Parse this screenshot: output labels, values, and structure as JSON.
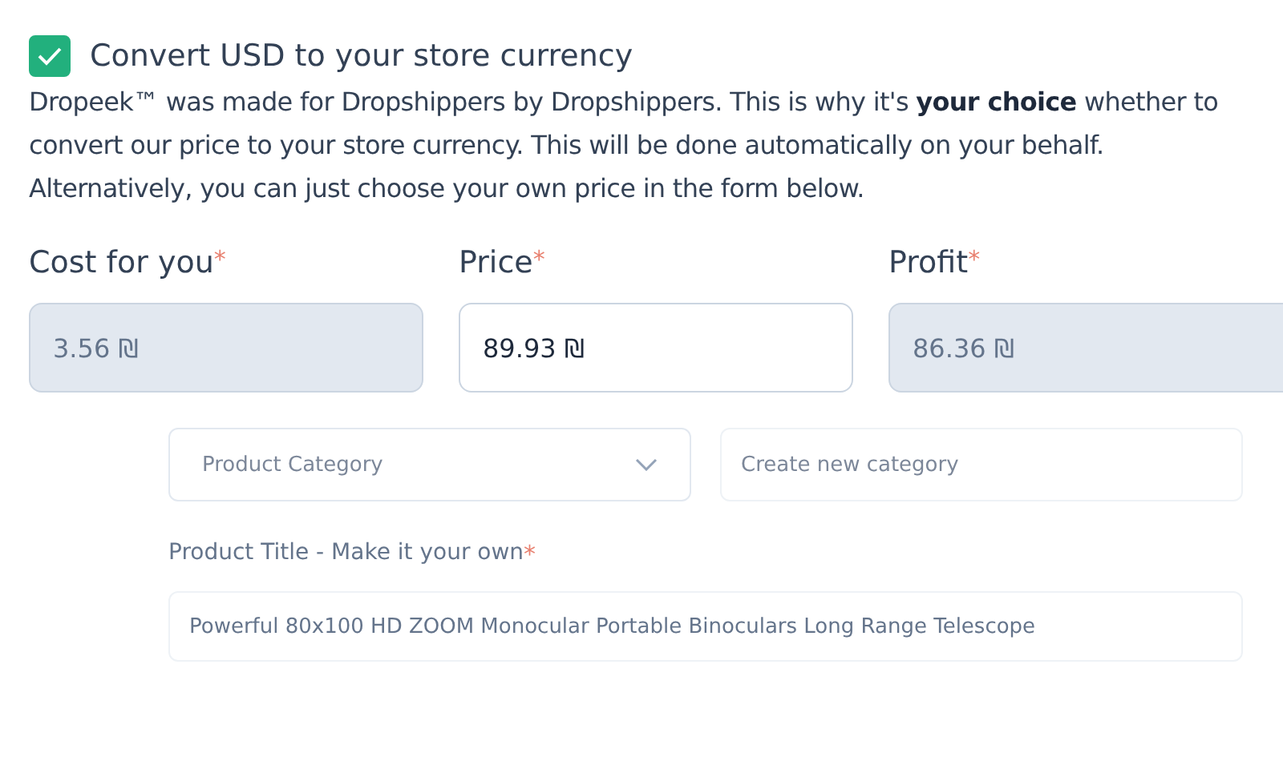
{
  "convert": {
    "checked": true,
    "label": "Convert USD to your store currency",
    "description": "Dropeek™ was made for Dropshippers by Dropshippers. This is why it's **your choice** whether to convert our price to your store currency. This will be done automatically on your behalf. Alternatively, you can just choose your own price in the form below."
  },
  "pricing_fields": [
    {
      "label": "Cost for you",
      "required_mark": "*",
      "value": "3.56 ₪",
      "disabled": true
    },
    {
      "label": "Price",
      "required_mark": "*",
      "value": "89.93 ₪",
      "disabled": false
    },
    {
      "label": "Profit",
      "required_mark": "*",
      "value": "86.36 ₪",
      "disabled": true
    }
  ],
  "category": {
    "select_placeholder": "Product Category",
    "new_category_placeholder": "Create new category"
  },
  "title_field": {
    "label": "Product Title - Make it your own",
    "required_mark": "*",
    "value": "Powerful 80x100 HD ZOOM Monocular Portable Binoculars Long Range Telescope"
  }
}
